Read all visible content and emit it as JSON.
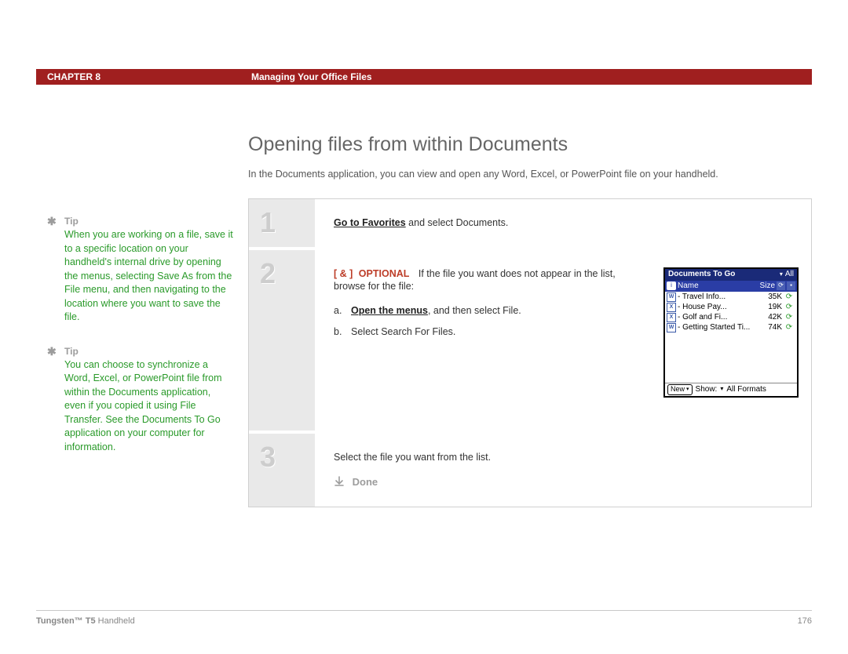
{
  "header": {
    "chapter": "CHAPTER 8",
    "title": "Managing Your Office Files"
  },
  "section_title": "Opening files from within Documents",
  "intro": "In the Documents application, you can view and open any Word, Excel, or PowerPoint file on your handheld.",
  "tips": [
    {
      "label": "Tip",
      "body": "When you are working on a file, save it to a specific location on your handheld's internal drive by opening the menus, selecting Save As from the File menu, and then navigating to the location where you want to save the file."
    },
    {
      "label": "Tip",
      "body": "You can choose to synchronize a Word, Excel, or PowerPoint file from within the Documents application, even if you copied it using File Transfer. See the Documents To Go application on your computer for information."
    }
  ],
  "steps": {
    "s1": {
      "num": "1",
      "link": "Go to Favorites",
      "rest": " and select Documents."
    },
    "s2": {
      "num": "2",
      "opt_brackets": "[ & ]",
      "opt_label": "OPTIONAL",
      "lead": "If the file you want does not appear in the list, browse for the file:",
      "a_label": "a.",
      "a_bold": "Open the menus",
      "a_rest": ", and then select File.",
      "b_label": "b.",
      "b_text": "Select Search For Files."
    },
    "s3": {
      "num": "3",
      "text": "Select the file you want from the list.",
      "done": "Done"
    }
  },
  "palm": {
    "title": "Documents To Go",
    "dropdown": "All",
    "col_name": "Name",
    "col_size": "Size",
    "rows": [
      {
        "ico": "W",
        "name": "- Travel Info...",
        "size": "35K"
      },
      {
        "ico": "X",
        "name": "- House Pay...",
        "size": "19K"
      },
      {
        "ico": "X",
        "name": "- Golf and Fi...",
        "size": "42K"
      },
      {
        "ico": "W",
        "name": "- Getting Started Ti...",
        "size": "74K"
      }
    ],
    "new_btn": "New",
    "show_lbl": "Show:",
    "show_val": "All Formats"
  },
  "footer": {
    "model_bold": "Tungsten™ T5",
    "model_rest": " Handheld",
    "page": "176"
  }
}
